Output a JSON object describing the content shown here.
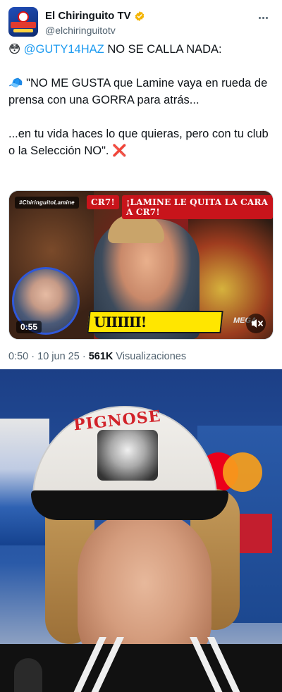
{
  "account": {
    "display_name": "El Chiringuito TV",
    "handle": "@elchiringuitotv",
    "verified_color": "#f4b400"
  },
  "icons": {
    "verified": "verified-badge-icon",
    "more": "more-options-icon",
    "mute": "mute-icon"
  },
  "tweet": {
    "line1_emoji": "😳",
    "line1_mention": "@GUTY14HAZ",
    "line1_text": " NO SE CALLA NADA:",
    "quote_emoji": "🧢",
    "quote_text": " \"NO ME GUSTA que Lamine vaya en rueda de prensa con una GORRA para atrás...",
    "second_text": "...en tu vida haces lo que quieras, pero con tu club o la Selección NO\". ",
    "second_emoji": "❌"
  },
  "video": {
    "brand_chip": "#ChiringuitoLamine",
    "cr7_chip": "CR7!",
    "title_chip": "¡LAMINE LE QUITA LA CARA A CR7!",
    "ticker": "UIIIIII!",
    "duration": "0:55",
    "channel": "MEGA"
  },
  "meta": {
    "time": "0:50",
    "separator1": " · ",
    "date": "10 jun 25",
    "separator2": " · ",
    "views_count": "561K",
    "views_label": " Visualizaciones"
  },
  "photo": {
    "cap_text": "PIGNOSE"
  },
  "colors": {
    "link": "#1d9bf0",
    "muted": "#536471",
    "text": "#0f1419"
  }
}
